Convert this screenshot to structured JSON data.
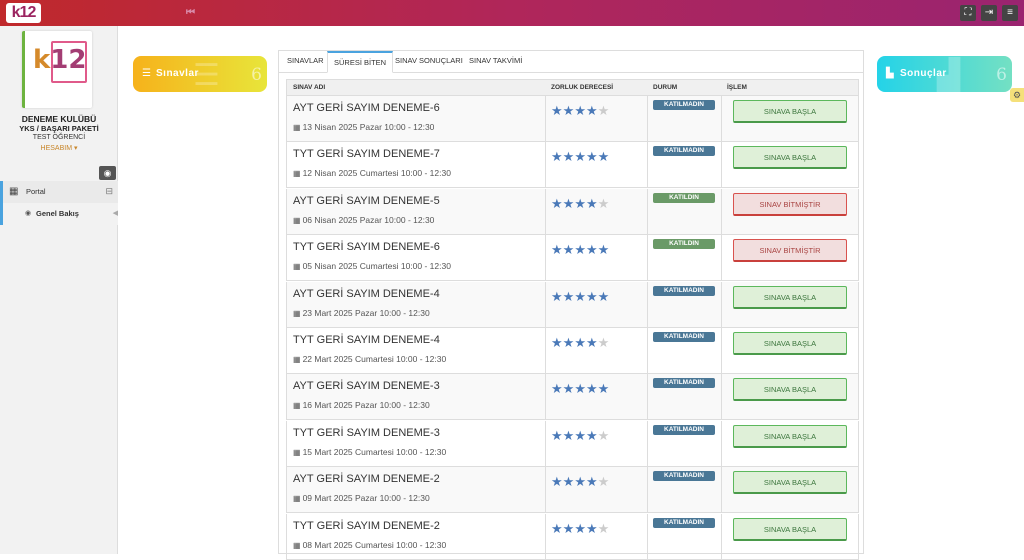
{
  "topbar": {
    "logo": "k12",
    "collapse_icon": "collapse-icon",
    "icons": [
      "fullscreen-icon",
      "logout-icon",
      "menu-icon"
    ]
  },
  "sidebar": {
    "club": "DENEME KULÜBÜ",
    "package": "YKS / BAŞARI PAKETİ",
    "role": "TEST ÖĞRENCİ",
    "account": "HESABIM ▾",
    "items": [
      {
        "label": "Portal",
        "icon": "grid-icon"
      },
      {
        "label": "Genel Bakış",
        "icon": "dashboard-icon"
      }
    ]
  },
  "cards": {
    "left": {
      "label": "Sınavlar",
      "count": "6",
      "color": "#f6b21b"
    },
    "right": {
      "label": "Sonuçlar",
      "count": "6",
      "color": "#24d3e8"
    }
  },
  "tabs": [
    "SINAVLAR",
    "SÜRESİ BİTEN",
    "SINAV SONUÇLARI",
    "SINAV TAKVİMİ"
  ],
  "active_tab": "SÜRESİ BİTEN",
  "table": {
    "headers": [
      "SINAV ADI",
      "ZORLUK DERECESİ",
      "DURUM",
      "İŞLEM"
    ],
    "rows": [
      {
        "name": "AYT GERİ SAYIM DENEME-6",
        "date": "13 Nisan 2025 Pazar 10:00 - 12:30",
        "stars": 4,
        "status": "KATILMADIN",
        "action": "SINAVA BAŞLA",
        "type": "start"
      },
      {
        "name": "TYT GERİ SAYIM DENEME-7",
        "date": "12 Nisan 2025 Cumartesi 10:00 - 12:30",
        "stars": 5,
        "status": "KATILMADIN",
        "action": "SINAVA BAŞLA",
        "type": "start"
      },
      {
        "name": "AYT GERİ SAYIM DENEME-5",
        "date": "06 Nisan 2025 Pazar 10:00 - 12:30",
        "stars": 4,
        "status": "KATILDIN",
        "action": "SINAV BİTMİŞTİR",
        "type": "ended"
      },
      {
        "name": "TYT GERİ SAYIM DENEME-6",
        "date": "05 Nisan 2025 Cumartesi 10:00 - 12:30",
        "stars": 5,
        "status": "KATILDIN",
        "action": "SINAV BİTMİŞTİR",
        "type": "ended"
      },
      {
        "name": "AYT GERİ SAYIM DENEME-4",
        "date": "23 Mart 2025 Pazar 10:00 - 12:30",
        "stars": 5,
        "status": "KATILMADIN",
        "action": "SINAVA BAŞLA",
        "type": "start"
      },
      {
        "name": "TYT GERİ SAYIM DENEME-4",
        "date": "22 Mart 2025 Cumartesi 10:00 - 12:30",
        "stars": 4,
        "status": "KATILMADIN",
        "action": "SINAVA BAŞLA",
        "type": "start"
      },
      {
        "name": "AYT GERİ SAYIM DENEME-3",
        "date": "16 Mart 2025 Pazar 10:00 - 12:30",
        "stars": 5,
        "status": "KATILMADIN",
        "action": "SINAVA BAŞLA",
        "type": "start"
      },
      {
        "name": "TYT GERİ SAYIM DENEME-3",
        "date": "15 Mart 2025 Cumartesi 10:00 - 12:30",
        "stars": 4,
        "status": "KATILMADIN",
        "action": "SINAVA BAŞLA",
        "type": "start"
      },
      {
        "name": "AYT GERİ SAYIM DENEME-2",
        "date": "09 Mart 2025 Pazar 10:00 - 12:30",
        "stars": 4,
        "status": "KATILMADIN",
        "action": "SINAVA BAŞLA",
        "type": "start"
      },
      {
        "name": "TYT GERİ SAYIM DENEME-2",
        "date": "08 Mart 2025 Cumartesi 10:00 - 12:30",
        "stars": 4,
        "status": "KATILMADIN",
        "action": "SINAVA BAŞLA",
        "type": "start"
      }
    ]
  }
}
